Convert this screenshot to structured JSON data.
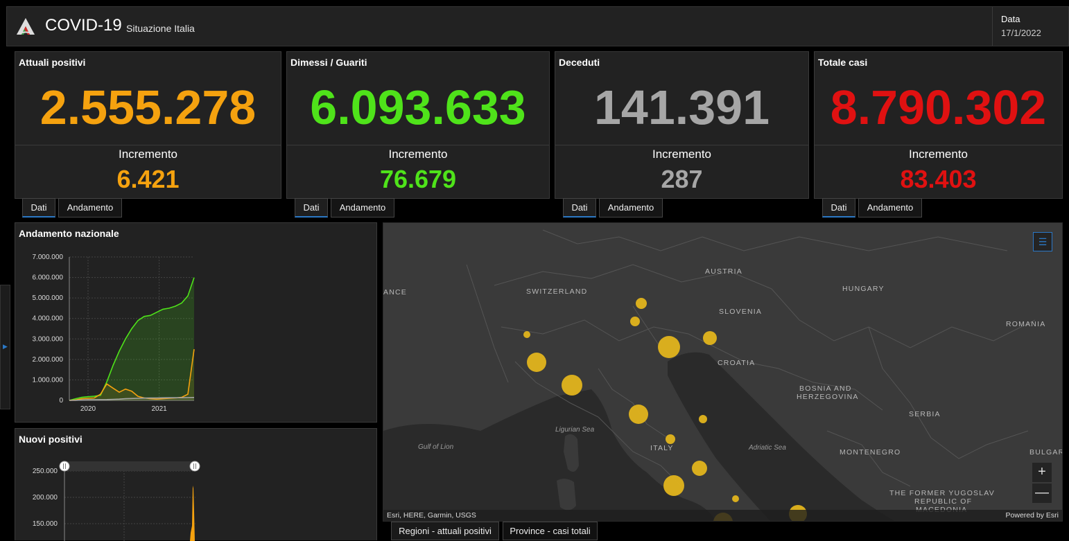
{
  "header": {
    "title": "COVID-19",
    "subtitle": "Situazione Italia",
    "date_label": "Data",
    "date_value": "17/1/2022"
  },
  "colors": {
    "orange": "#f5a20f",
    "green": "#4fe31a",
    "gray": "#a6a6a6",
    "red": "#e01111",
    "accent": "#2b78c6",
    "bubble": "#e2b41c"
  },
  "cards": [
    {
      "title": "Attuali positivi",
      "value": "2.555.278",
      "inc_label": "Incremento",
      "inc_value": "6.421",
      "tab_dati": "Dati",
      "tab_andamento": "Andamento"
    },
    {
      "title": "Dimessi / Guariti",
      "value": "6.093.633",
      "inc_label": "Incremento",
      "inc_value": "76.679",
      "tab_dati": "Dati",
      "tab_andamento": "Andamento"
    },
    {
      "title": "Deceduti",
      "value": "141.391",
      "inc_label": "Incremento",
      "inc_value": "287",
      "tab_dati": "Dati",
      "tab_andamento": "Andamento"
    },
    {
      "title": "Totale casi",
      "value": "8.790.302",
      "inc_label": "Incremento",
      "inc_value": "83.403",
      "tab_dati": "Dati",
      "tab_andamento": "Andamento"
    }
  ],
  "chart_data": [
    {
      "type": "area",
      "title": "Andamento nazionale",
      "x_ticks": [
        "2020",
        "2021"
      ],
      "y_ticks": [
        "0",
        "1.000.000",
        "2.000.000",
        "3.000.000",
        "4.000.000",
        "5.000.000",
        "6.000.000",
        "7.000.000"
      ],
      "ylim": [
        0,
        7000000
      ],
      "x": [
        0,
        0.05,
        0.1,
        0.15,
        0.2,
        0.25,
        0.3,
        0.35,
        0.4,
        0.45,
        0.5,
        0.55,
        0.6,
        0.65,
        0.7,
        0.75,
        0.8,
        0.85,
        0.9,
        0.95,
        1.0
      ],
      "series": [
        {
          "color": "#4fe31a",
          "values": [
            0,
            80000,
            150000,
            180000,
            200000,
            250000,
            900000,
            1700000,
            2400000,
            3000000,
            3500000,
            3900000,
            4100000,
            4150000,
            4300000,
            4450000,
            4500000,
            4600000,
            4750000,
            5100000,
            6000000
          ]
        },
        {
          "color": "#f5a20f",
          "values": [
            0,
            20000,
            80000,
            100000,
            120000,
            300000,
            800000,
            600000,
            400000,
            550000,
            450000,
            200000,
            120000,
            80000,
            60000,
            80000,
            100000,
            120000,
            150000,
            300000,
            2500000
          ]
        },
        {
          "color": "#a6a6a6",
          "values": [
            0,
            5000,
            20000,
            30000,
            35000,
            36000,
            40000,
            50000,
            60000,
            80000,
            90000,
            100000,
            110000,
            115000,
            120000,
            125000,
            127000,
            128000,
            130000,
            135000,
            141000
          ]
        }
      ]
    },
    {
      "type": "bar",
      "title": "Nuovi positivi",
      "y_ticks": [
        "150.000",
        "200.000",
        "250.000"
      ],
      "ylim": [
        130000,
        270000
      ]
    }
  ],
  "map": {
    "labels": [
      {
        "text": "AUSTRIA",
        "left": 464,
        "top": 64
      },
      {
        "text": "SWITZERLAND",
        "left": 206,
        "top": 93
      },
      {
        "text": "ANCE",
        "left": 0,
        "top": 94
      },
      {
        "text": "HUNGARY",
        "left": 662,
        "top": 89
      },
      {
        "text": "SLOVENIA",
        "left": 484,
        "top": 122
      },
      {
        "text": "ROMANIA",
        "left": 898,
        "top": 140
      },
      {
        "text": "CROATIA",
        "left": 482,
        "top": 196
      },
      {
        "text": "BOSNIA AND",
        "left": 600,
        "top": 233
      },
      {
        "text": "HERZEGOVINA",
        "left": 596,
        "top": 245
      },
      {
        "text": "SERBIA",
        "left": 758,
        "top": 270
      },
      {
        "text": "ITALY",
        "left": 385,
        "top": 319
      },
      {
        "text": "MONTENEGRO",
        "left": 658,
        "top": 325
      },
      {
        "text": "BULGARI",
        "left": 932,
        "top": 325
      },
      {
        "text": "THE FORMER YUGOSLAV",
        "left": 730,
        "top": 384
      },
      {
        "text": "REPUBLIC OF",
        "left": 766,
        "top": 396
      },
      {
        "text": "MACEDONIA",
        "left": 768,
        "top": 408
      }
    ],
    "seas": [
      {
        "text": "Ligurian Sea",
        "left": 248,
        "top": 293
      },
      {
        "text": "Gulf of Lion",
        "left": 50,
        "top": 318
      },
      {
        "text": "Adriatic Sea",
        "left": 527,
        "top": 319
      }
    ],
    "attribution_left": "Esri, HERE, Garmin, USGS",
    "attribution_right": "Powered by Esri",
    "tabs": [
      "Regioni - attuali positivi",
      "Province - casi totali"
    ]
  }
}
